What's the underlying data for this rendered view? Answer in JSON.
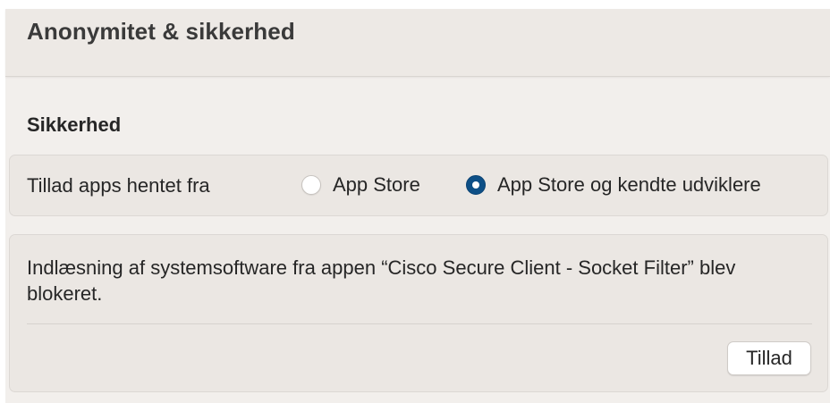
{
  "window": {
    "title": "Anonymitet & sikkerhed"
  },
  "security": {
    "heading": "Sikkerhed",
    "allow_apps": {
      "label": "Tillad apps hentet fra",
      "options": [
        {
          "label": "App Store",
          "selected": false
        },
        {
          "label": "App Store og kendte udviklere",
          "selected": true
        }
      ]
    },
    "blocked_notice": {
      "message": "Indlæsning af systemsoftware fra appen “Cisco Secure Client - Socket Filter” blev blokeret.",
      "allow_button_label": "Tillad"
    }
  },
  "colors": {
    "accent": "#0d4f86",
    "window_background": "#f2efec",
    "panel_background": "#ebe7e3"
  }
}
